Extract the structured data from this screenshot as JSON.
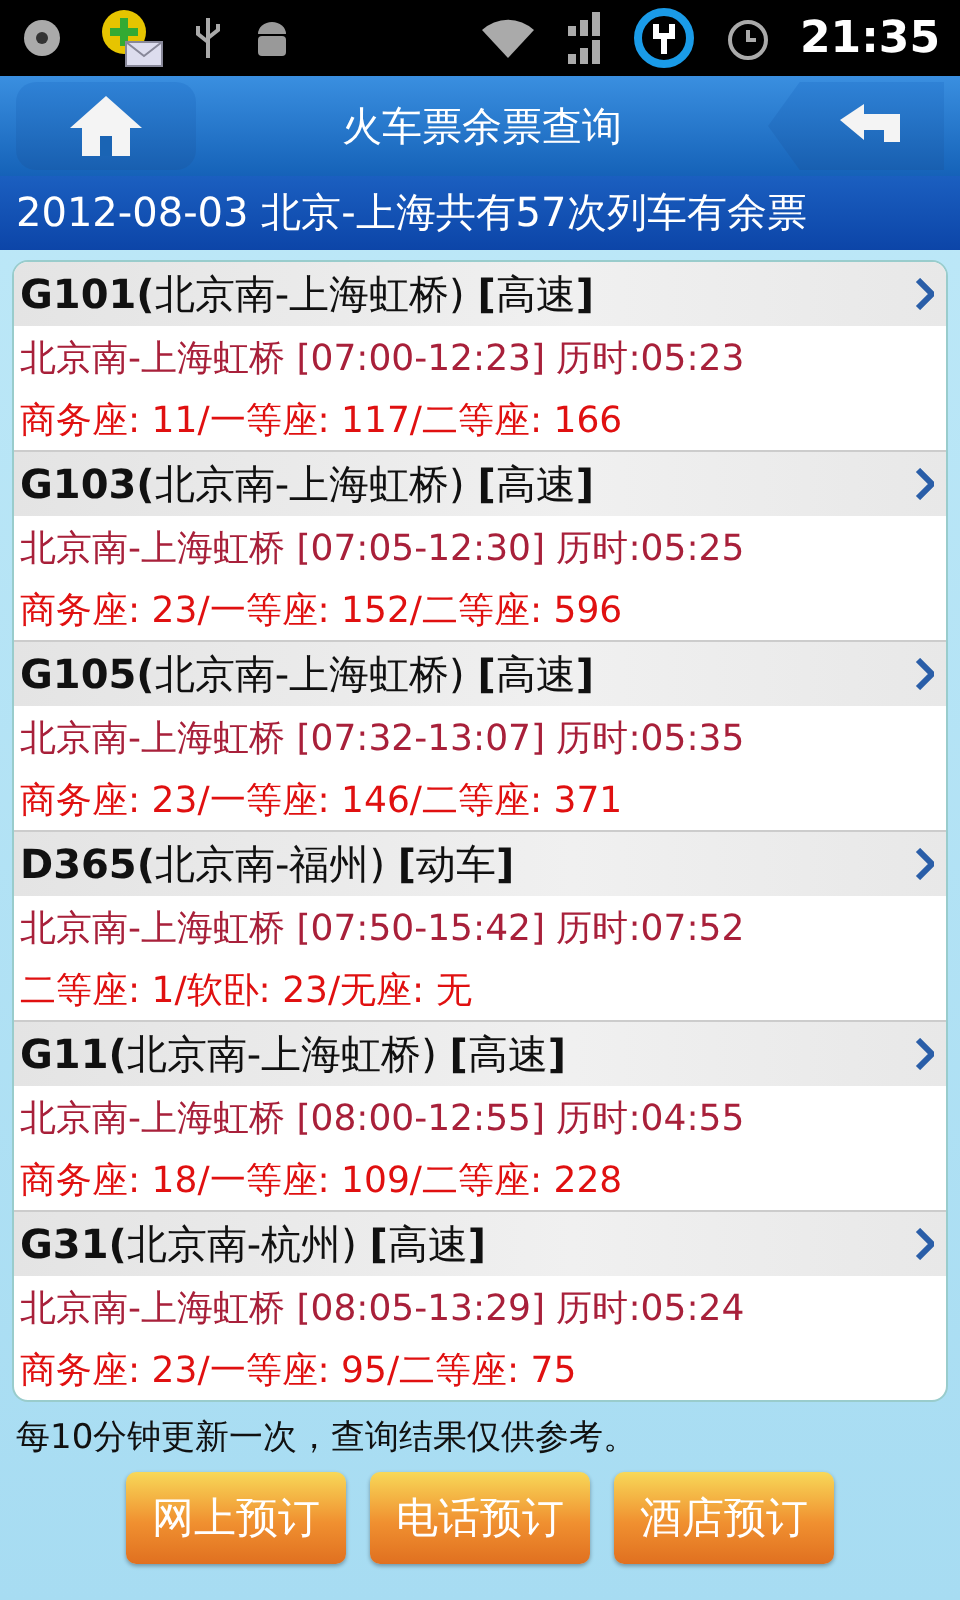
{
  "status_bar": {
    "time": "21:35"
  },
  "header": {
    "title": "火车票余票查询"
  },
  "summary": "2012-08-03 北京-上海共有57次列车有余票",
  "trains": [
    {
      "title": "**G101(**北京南-上海虹桥) **[**高速**]**",
      "route": "北京南-上海虹桥 [07:00-12:23] 历时:05:23",
      "seats": "商务座: 11/一等座: 117/二等座: 166"
    },
    {
      "title": "**G103(**北京南-上海虹桥) **[**高速**]**",
      "route": "北京南-上海虹桥 [07:05-12:30] 历时:05:25",
      "seats": "商务座: 23/一等座: 152/二等座: 596"
    },
    {
      "title": "**G105(**北京南-上海虹桥) **[**高速**]**",
      "route": "北京南-上海虹桥 [07:32-13:07] 历时:05:35",
      "seats": "商务座: 23/一等座: 146/二等座: 371"
    },
    {
      "title": "**D365(**北京南-福州) **[**动车**]**",
      "route": "北京南-上海虹桥 [07:50-15:42] 历时:07:52",
      "seats": "二等座: 1/软卧: 23/无座: 无"
    },
    {
      "title": "**G11(**北京南-上海虹桥) **[**高速**]**",
      "route": "北京南-上海虹桥 [08:00-12:55] 历时:04:55",
      "seats": "商务座: 18/一等座: 109/二等座: 228"
    },
    {
      "title": "**G31(**北京南-杭州) **[**高速**]**",
      "route": "北京南-上海虹桥 [08:05-13:29] 历时:05:24",
      "seats": "商务座: 23/一等座: 95/二等座: 75"
    }
  ],
  "note": "每10分钟更新一次，查询结果仅供参考。",
  "buttons": [
    "网上预订",
    "电话预订",
    "酒店预订"
  ]
}
